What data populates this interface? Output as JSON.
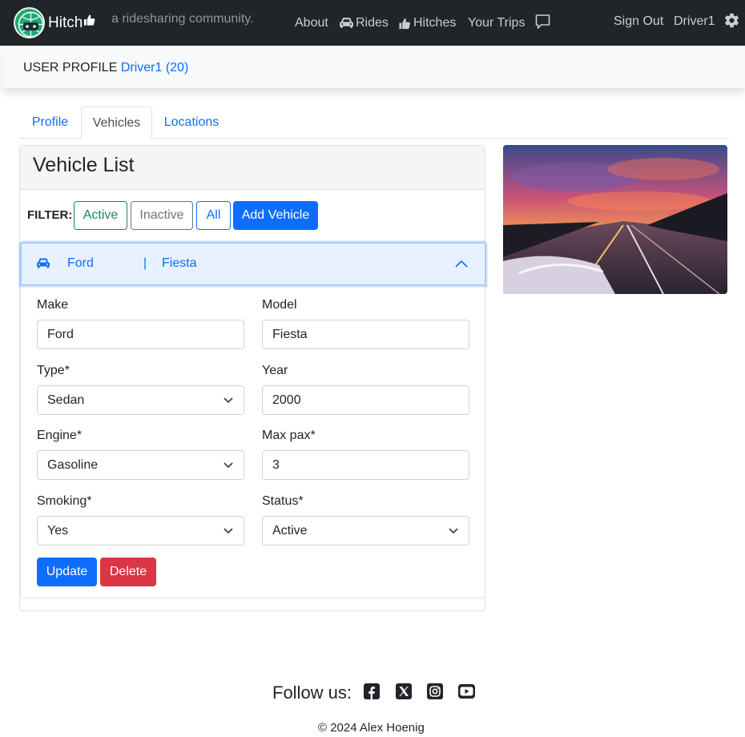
{
  "navbar": {
    "brand": "Hitch",
    "tagline": "a ridesharing community.",
    "links": {
      "about": "About",
      "rides": "Rides",
      "hitches": "Hitches",
      "trips": "Your Trips",
      "signout": "Sign Out",
      "user": "Driver1"
    }
  },
  "header": {
    "title": "USER PROFILE",
    "user_link": "Driver1 (20)"
  },
  "tabs": [
    "Profile",
    "Vehicles",
    "Locations"
  ],
  "vehicle_list": {
    "title": "Vehicle List",
    "filter_label": "FILTER:",
    "filters": {
      "active": "Active",
      "inactive": "Inactive",
      "all": "All",
      "add": "Add Vehicle"
    },
    "vehicle": {
      "make": "Ford",
      "separator": "|",
      "model": "Fiesta",
      "fields": {
        "make_label": "Make",
        "make_value": "Ford",
        "model_label": "Model",
        "model_value": "Fiesta",
        "type_label": "Type*",
        "type_value": "Sedan",
        "year_label": "Year",
        "year_value": "2000",
        "engine_label": "Engine*",
        "engine_value": "Gasoline",
        "maxpax_label": "Max pax*",
        "maxpax_value": "3",
        "smoking_label": "Smoking*",
        "smoking_value": "Yes",
        "status_label": "Status*",
        "status_value": "Active"
      },
      "update": "Update",
      "delete": "Delete"
    }
  },
  "footer": {
    "follow": "Follow us:",
    "copyright": "© 2024 Alex Hoenig"
  },
  "colors": {
    "primary": "#0d6efd",
    "success": "#198754",
    "danger": "#dc3545",
    "navbar": "#212529"
  }
}
